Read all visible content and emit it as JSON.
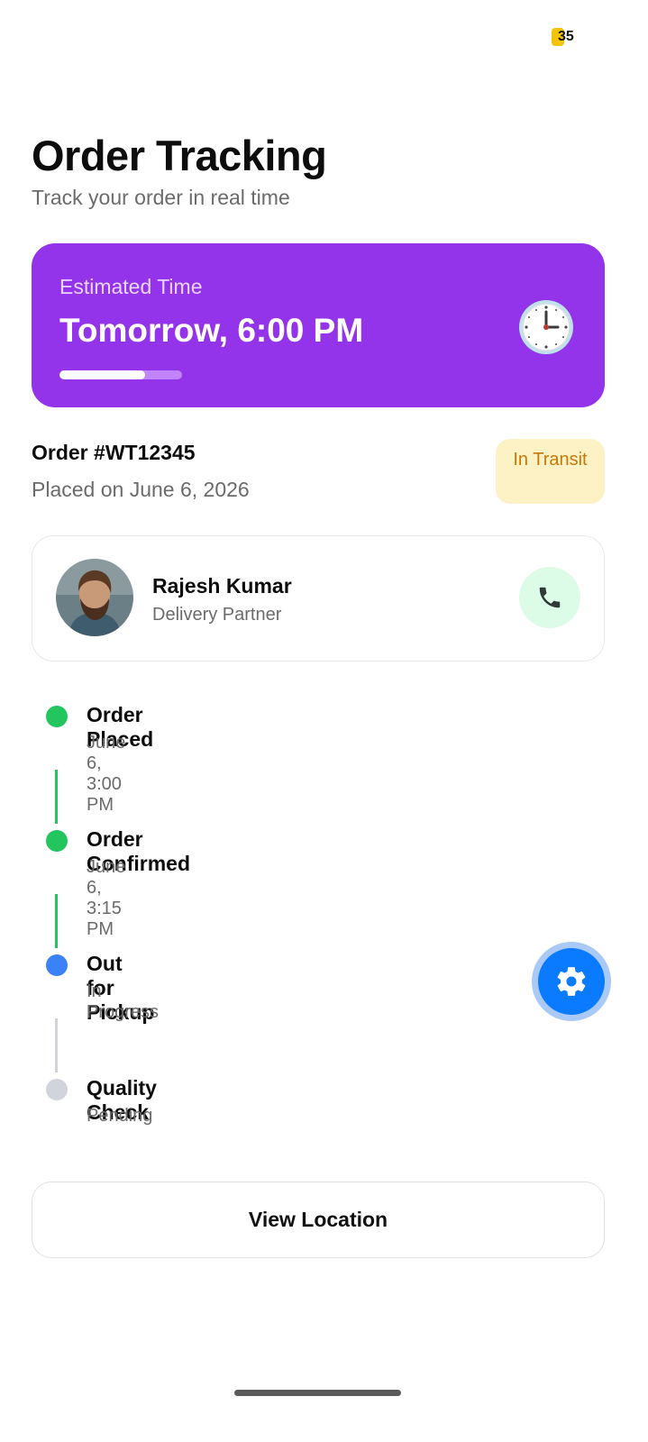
{
  "status_bar": {
    "battery": "35"
  },
  "header": {
    "title": "Order Tracking",
    "subtitle": "Track your order in real time"
  },
  "eta": {
    "label": "Estimated Time",
    "value": "Tomorrow, 6:00 PM",
    "progress_percent": 70,
    "icon": "clock-icon",
    "colors": {
      "card": "#9333ea"
    }
  },
  "order": {
    "id": "Order #WT12345",
    "placed": "Placed on June 6, 2026",
    "status": "In Transit"
  },
  "partner": {
    "name": "Rajesh Kumar",
    "role": "Delivery Partner",
    "call_icon": "phone-icon"
  },
  "timeline": [
    {
      "title": "Order Placed",
      "subtitle": "June 6, 3:00 PM",
      "state": "done"
    },
    {
      "title": "Order Confirmed",
      "subtitle": "June 6, 3:15 PM",
      "state": "done"
    },
    {
      "title": "Out for Pickup",
      "subtitle": "In Progress",
      "state": "active"
    },
    {
      "title": "Quality Check",
      "subtitle": "Pending",
      "state": "pending"
    }
  ],
  "colors": {
    "done": "#22c55e",
    "active": "#3b82f6",
    "pending": "#d1d5db"
  },
  "fab": {
    "icon": "gear-icon"
  },
  "actions": {
    "view_location": "View Location"
  }
}
